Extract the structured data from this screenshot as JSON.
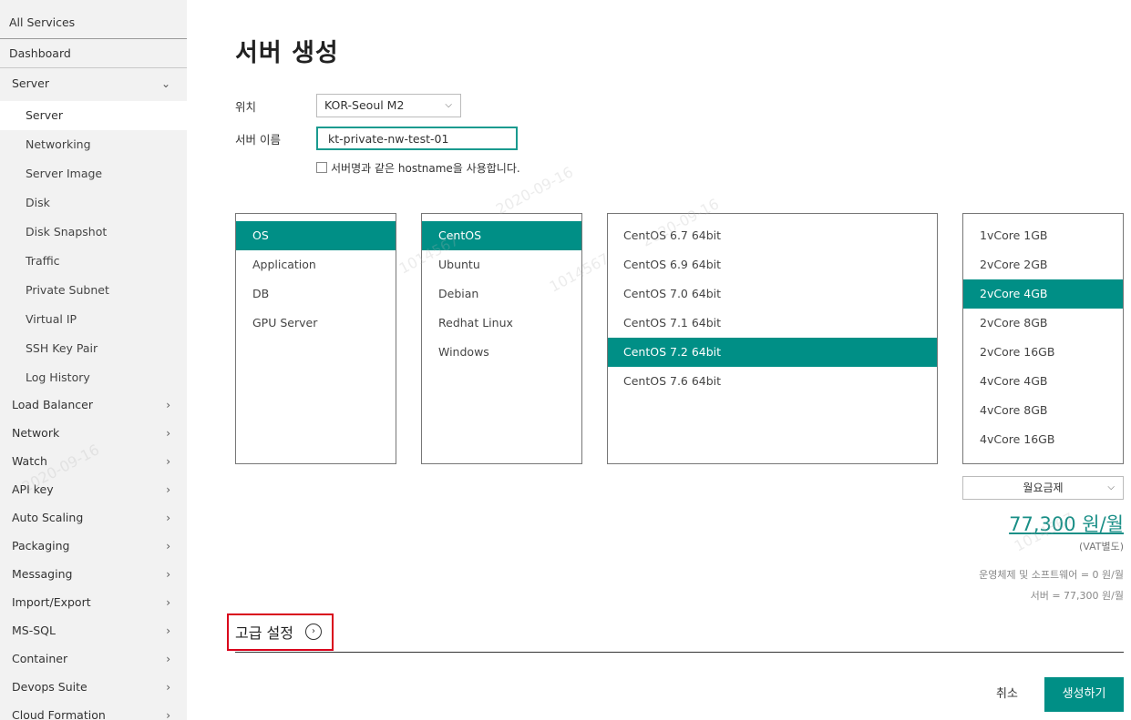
{
  "sidebar": {
    "all_services": "All Services",
    "dashboard": "Dashboard",
    "server_group": "Server",
    "server_items": [
      "Server",
      "Networking",
      "Server Image",
      "Disk",
      "Disk Snapshot",
      "Traffic",
      "Private Subnet",
      "Virtual IP",
      "SSH Key Pair",
      "Log History"
    ],
    "groups": [
      "Load Balancer",
      "Network",
      "Watch",
      "API key",
      "Auto Scaling",
      "Packaging",
      "Messaging",
      "Import/Export",
      "MS-SQL",
      "Container",
      "Devops Suite",
      "Cloud Formation"
    ]
  },
  "page": {
    "title": "서버 생성",
    "location_label": "위치",
    "location_value": "KOR-Seoul M2",
    "name_label": "서버 이름",
    "name_value": "kt-private-nw-test-01",
    "hostname_checkbox": "서버명과 같은 hostname을 사용합니다."
  },
  "panels": {
    "categories": {
      "items": [
        "OS",
        "Application",
        "DB",
        "GPU Server"
      ],
      "selected": "OS"
    },
    "distros": {
      "items": [
        "CentOS",
        "Ubuntu",
        "Debian",
        "Redhat Linux",
        "Windows"
      ],
      "selected": "CentOS"
    },
    "versions": {
      "items": [
        "CentOS 6.7 64bit",
        "CentOS 6.9 64bit",
        "CentOS 7.0 64bit",
        "CentOS 7.1 64bit",
        "CentOS 7.2 64bit",
        "CentOS 7.6 64bit"
      ],
      "selected": "CentOS 7.2 64bit"
    },
    "specs": {
      "items": [
        "1vCore 1GB",
        "2vCore 2GB",
        "2vCore 4GB",
        "2vCore 8GB",
        "2vCore 16GB",
        "4vCore 4GB",
        "4vCore 8GB",
        "4vCore 16GB"
      ],
      "selected": "2vCore 4GB"
    }
  },
  "pricing": {
    "plan": "월요금제",
    "price": "77,300 원/월",
    "vat": "(VAT별도)",
    "os_note": "운영체제 및 소프트웨어 = 0 원/월",
    "server_note": "서버 = 77,300 원/월"
  },
  "advanced": {
    "label": "고급 설정"
  },
  "actions": {
    "cancel": "취소",
    "create": "생성하기"
  },
  "watermark": {
    "date": "2020-09-16",
    "id": "1014567"
  },
  "colors": {
    "accent": "#008f86",
    "highlight_box": "#d9001b",
    "sidebar_bg": "#f2f2f2"
  },
  "icons": {
    "group_collapsed": "chevron-right-icon",
    "group_expanded": "chevron-down-icon",
    "dropdown": "chevron-down-icon",
    "advanced": "chevron-right-circle-icon"
  }
}
